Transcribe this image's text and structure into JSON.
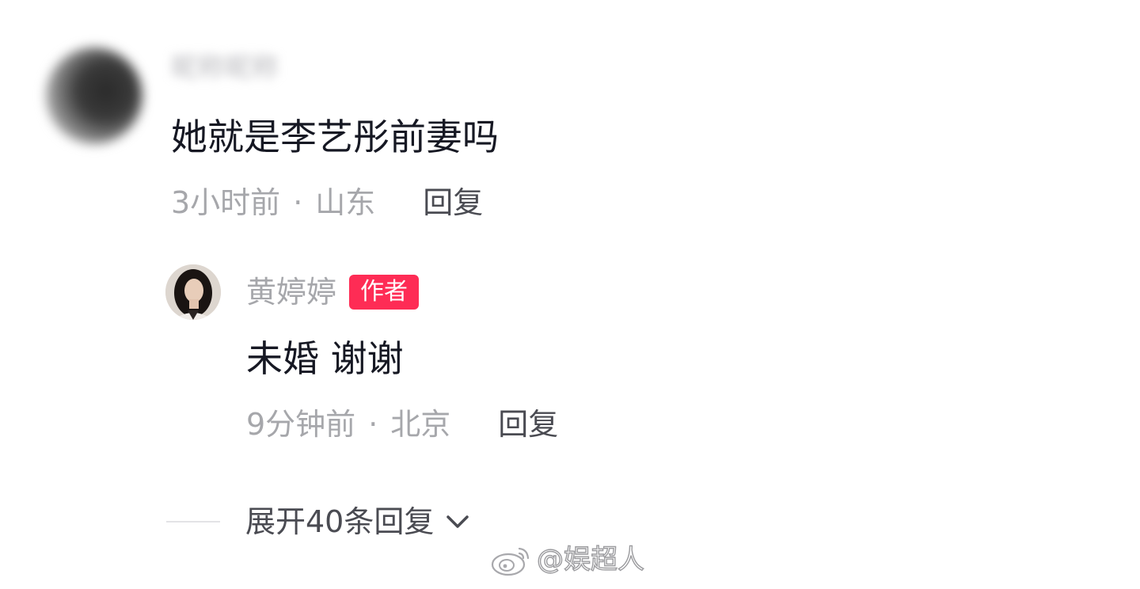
{
  "comment": {
    "username": "昵称昵称",
    "text": "她就是李艺彤前妻吗",
    "time": "3小时前",
    "separator": "·",
    "location": "山东",
    "reply_label": "回复"
  },
  "reply": {
    "username": "黄婷婷",
    "badge": "作者",
    "text": "未婚 谢谢",
    "time": "9分钟前",
    "separator": "·",
    "location": "北京",
    "reply_label": "回复"
  },
  "expand": {
    "label": "展开40条回复"
  },
  "watermark": {
    "text": "@娱超人"
  },
  "colors": {
    "badge_background": "#fe2c55",
    "primary_text": "#161823",
    "secondary_text": "#a6a7ab",
    "action_text": "#4a4b52"
  },
  "icons": {
    "expand": "chevron-down-icon",
    "watermark": "weibo-logo-icon"
  }
}
